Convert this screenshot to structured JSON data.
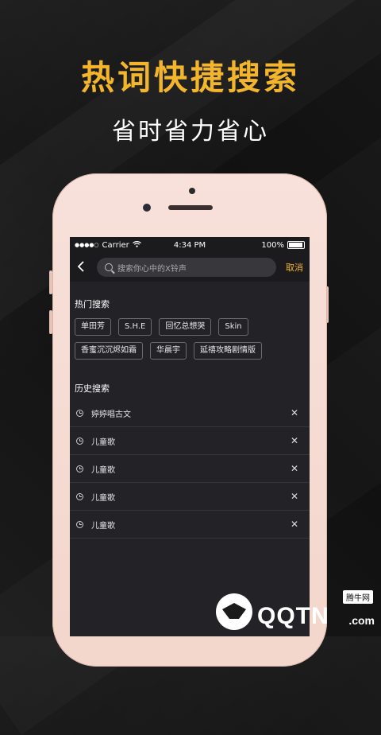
{
  "promo": {
    "headline": "热词快捷搜索",
    "subline": "省时省力省心",
    "accent_color": "#f3b52b"
  },
  "status_bar": {
    "carrier": "Carrier",
    "time": "4:34 PM",
    "battery": "100%",
    "icons": [
      "signal-dots-icon",
      "wifi-icon",
      "battery-icon"
    ]
  },
  "search": {
    "back_icon": "chevron-left-icon",
    "placeholder": "搜索你心中的X铃声",
    "cancel_label": "取消"
  },
  "hot_search": {
    "title": "热门搜索",
    "tags": [
      "单田芳",
      "S.H.E",
      "回忆总想哭",
      "Skin",
      "香蜜沉沉烬如霜",
      "华晨宇",
      "延禧攻略剧情版"
    ]
  },
  "history": {
    "title": "历史搜索",
    "items": [
      "婷婷唱古文",
      "儿童歌",
      "儿童歌",
      "儿童歌",
      "儿童歌"
    ]
  },
  "watermark": {
    "brand": "QQTN",
    "domain": ".com",
    "cn": "腾牛网"
  }
}
